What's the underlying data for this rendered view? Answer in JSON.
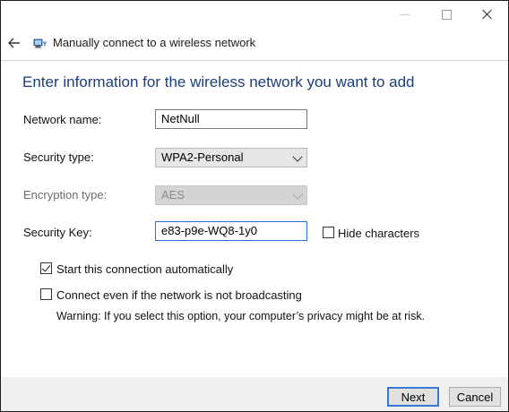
{
  "window": {
    "header_title": "Manually connect to a wireless network"
  },
  "main": {
    "heading": "Enter information for the wireless network you want to add"
  },
  "form": {
    "network_name": {
      "label": "Network name:",
      "value": "NetNull"
    },
    "security_type": {
      "label": "Security type:",
      "value": "WPA2-Personal"
    },
    "encryption_type": {
      "label": "Encryption type:",
      "value": "AES",
      "enabled": false
    },
    "security_key": {
      "label": "Security Key:",
      "value": "e83-p9e-WQ8-1y0"
    },
    "hide_characters": {
      "label": "Hide characters",
      "checked": false
    },
    "start_automatically": {
      "label": "Start this connection automatically",
      "checked": true
    },
    "connect_not_broadcasting": {
      "label": "Connect even if the network is not broadcasting",
      "checked": false
    },
    "warning": "Warning: If you select this option, your computer’s privacy might be at risk."
  },
  "footer": {
    "next_label": "Next",
    "cancel_label": "Cancel"
  },
  "icons": {
    "back": "back-arrow-icon",
    "network": "network-icon",
    "minimize": "minimize-icon",
    "maximize": "maximize-icon",
    "close": "close-icon"
  },
  "colors": {
    "heading": "#1a3e7a",
    "default_button_border": "#3579d3",
    "footer_bg": "#f0f0f0"
  }
}
